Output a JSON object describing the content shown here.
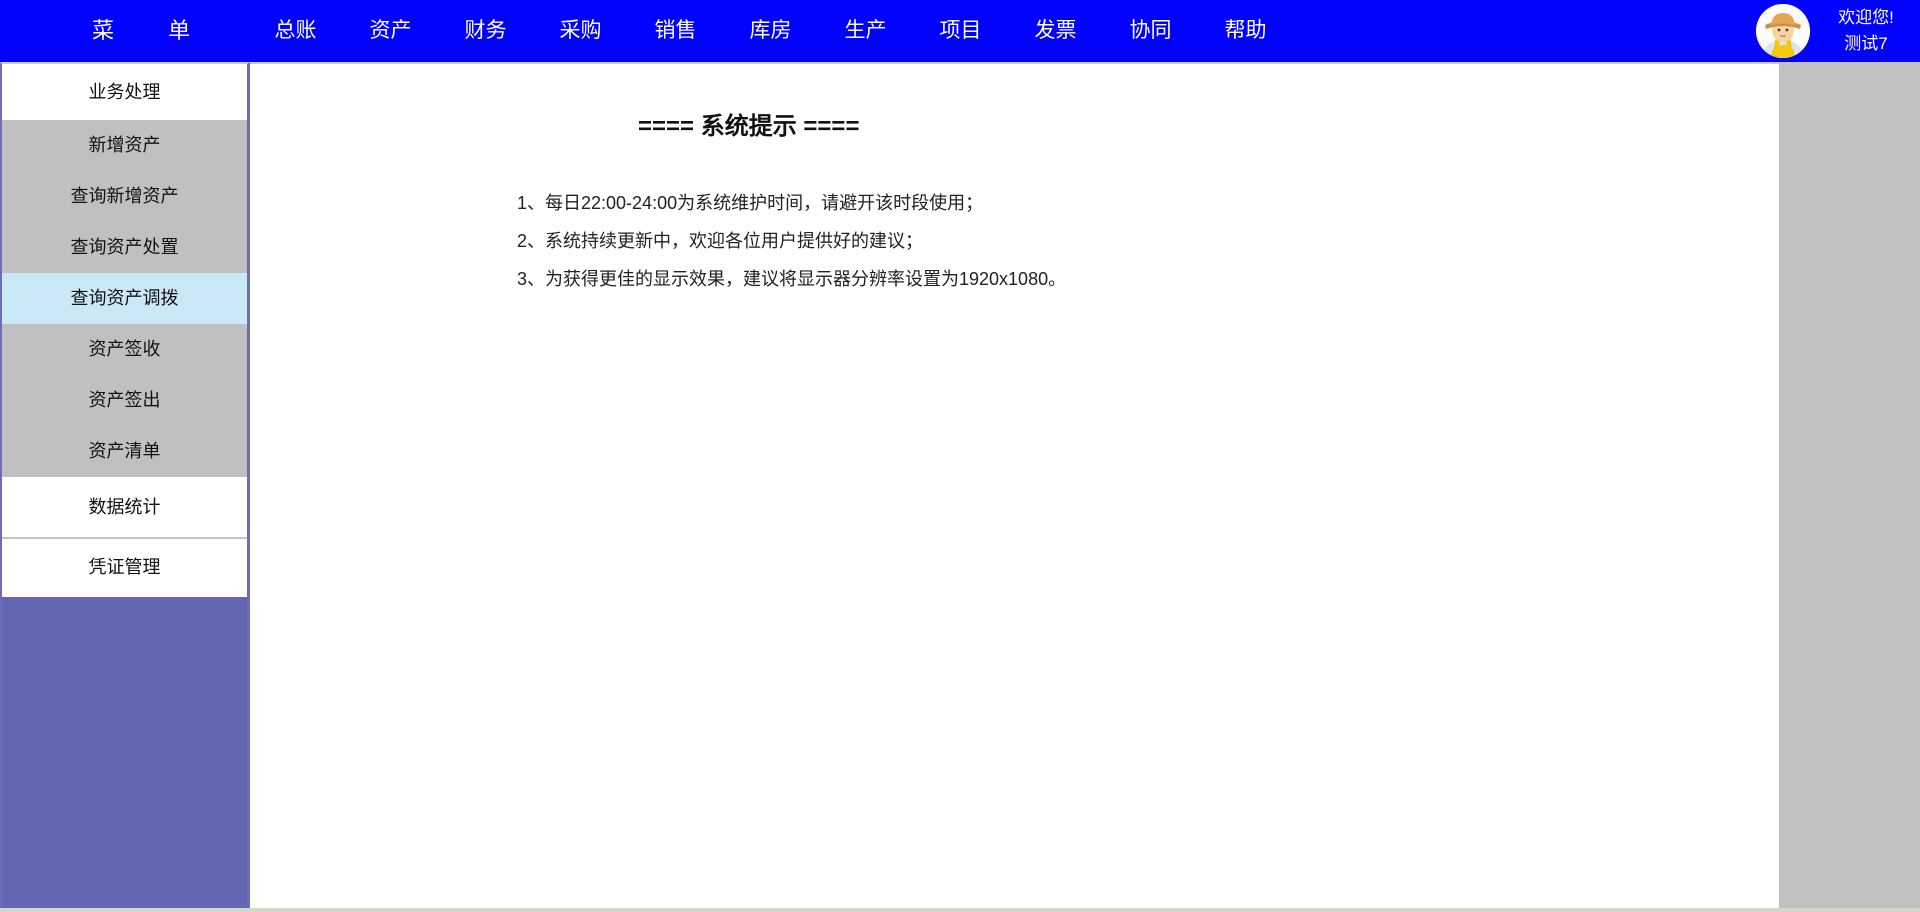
{
  "topbar": {
    "menu_label": "菜 单",
    "nav_items": [
      "总账",
      "资产",
      "财务",
      "采购",
      "销售",
      "库房",
      "生产",
      "项目",
      "发票",
      "协同",
      "帮助"
    ],
    "welcome_line1": "欢迎您!",
    "welcome_line2": "测试7",
    "avatar_icon": "farmer-avatar-icon"
  },
  "sidebar": {
    "items": [
      {
        "label": "业务处理",
        "type": "header"
      },
      {
        "label": "新增资产",
        "type": "item"
      },
      {
        "label": "查询新增资产",
        "type": "item"
      },
      {
        "label": "查询资产处置",
        "type": "item"
      },
      {
        "label": "查询资产调拨",
        "type": "item",
        "selected": true
      },
      {
        "label": "资产签收",
        "type": "item"
      },
      {
        "label": "资产签出",
        "type": "item"
      },
      {
        "label": "资产清单",
        "type": "item"
      },
      {
        "label": "数据统计",
        "type": "section"
      },
      {
        "label": "凭证管理",
        "type": "section"
      }
    ]
  },
  "main": {
    "title": "==== 系统提示 ====",
    "notices": [
      "1、每日22:00-24:00为系统维护时间，请避开该时段使用；",
      "2、系统持续更新中，欢迎各位用户提供好的建议；",
      "3、为获得更佳的显示效果，建议将显示器分辨率设置为1920x1080。"
    ]
  },
  "colors": {
    "topbar_bg": "#0101fe",
    "sidebar_fill": "#6366b2",
    "sidebar_border": "#6b6eb5",
    "item_gray": "#c0c0c0",
    "item_selected": "#cbe8f7",
    "right_panel_gray": "#c1c1c1",
    "bottom_track": "#d3d8c6"
  }
}
